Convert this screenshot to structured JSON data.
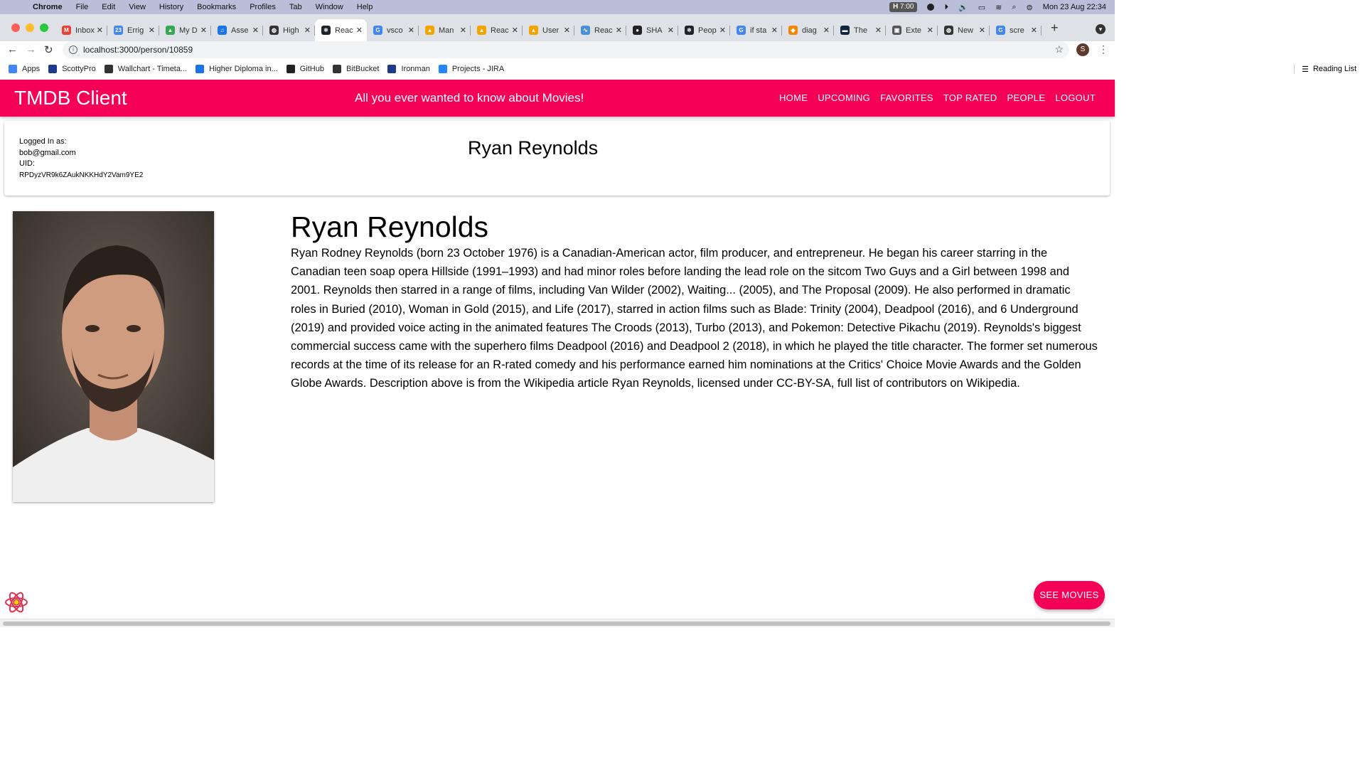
{
  "menubar": {
    "items": [
      "Chrome",
      "File",
      "Edit",
      "View",
      "History",
      "Bookmarks",
      "Profiles",
      "Tab",
      "Window",
      "Help"
    ],
    "badge": "7:00",
    "badge_letter": "H",
    "datetime": "Mon 23 Aug  22:34"
  },
  "tabs": [
    {
      "label": "Inbox",
      "favicon_color": "#ea4335",
      "favicon_glyph": "M",
      "active": false
    },
    {
      "label": "Errig",
      "favicon_color": "#4285f4",
      "favicon_glyph": "23",
      "active": false
    },
    {
      "label": "My D",
      "favicon_color": "#34a853",
      "favicon_glyph": "▲",
      "active": false
    },
    {
      "label": "Asse",
      "favicon_color": "#1a73e8",
      "favicon_glyph": "♫",
      "active": false
    },
    {
      "label": "High",
      "favicon_color": "#333333",
      "favicon_glyph": "◍",
      "active": false
    },
    {
      "label": "Reac",
      "favicon_color": "#20232a",
      "favicon_glyph": "⚛",
      "active": true
    },
    {
      "label": "vsco",
      "favicon_color": "#4285f4",
      "favicon_glyph": "G",
      "active": false
    },
    {
      "label": "Man",
      "favicon_color": "#f4a400",
      "favicon_glyph": "▲",
      "active": false
    },
    {
      "label": "Reac",
      "favicon_color": "#f4a400",
      "favicon_glyph": "▲",
      "active": false
    },
    {
      "label": "User",
      "favicon_color": "#f4a400",
      "favicon_glyph": "▲",
      "active": false
    },
    {
      "label": "Reac",
      "favicon_color": "#4a90d9",
      "favicon_glyph": "∿",
      "active": false
    },
    {
      "label": "SHA",
      "favicon_color": "#222222",
      "favicon_glyph": "●",
      "active": false
    },
    {
      "label": "Peop",
      "favicon_color": "#20232a",
      "favicon_glyph": "⚛",
      "active": false
    },
    {
      "label": "if sta",
      "favicon_color": "#4285f4",
      "favicon_glyph": "G",
      "active": false
    },
    {
      "label": "diag",
      "favicon_color": "#f08705",
      "favicon_glyph": "◆",
      "active": false
    },
    {
      "label": "The",
      "favicon_color": "#0d253f",
      "favicon_glyph": "▬",
      "active": false
    },
    {
      "label": "Exte",
      "favicon_color": "#555555",
      "favicon_glyph": "▣",
      "active": false
    },
    {
      "label": "New",
      "favicon_color": "#333333",
      "favicon_glyph": "◍",
      "active": false
    },
    {
      "label": "scre",
      "favicon_color": "#4285f4",
      "favicon_glyph": "G",
      "active": false
    }
  ],
  "address": {
    "url": "localhost:3000/person/10859"
  },
  "bookmarks": [
    {
      "label": "Apps",
      "color": "#4285f4"
    },
    {
      "label": "ScottyPro",
      "color": "#1e3a8a"
    },
    {
      "label": "Wallchart - Timeta...",
      "color": "#333333"
    },
    {
      "label": "Higher Diploma in...",
      "color": "#1a73e8"
    },
    {
      "label": "GitHub",
      "color": "#222222"
    },
    {
      "label": "BitBucket",
      "color": "#333333"
    },
    {
      "label": "Ironman",
      "color": "#1e3a8a"
    },
    {
      "label": "Projects - JIRA",
      "color": "#2684ff"
    }
  ],
  "reading_list": "Reading List",
  "app": {
    "brand": "TMDB Client",
    "tagline": "All you ever wanted to know about Movies!",
    "nav": [
      "HOME",
      "UPCOMING",
      "FAVORITES",
      "TOP RATED",
      "PEOPLE",
      "LOGOUT"
    ],
    "accent": "#f50057"
  },
  "user": {
    "logged_label": "Logged In as:",
    "email": "bob@gmail.com",
    "uid_label": "UID:",
    "uid": "RPDyzVR9k6ZAukNKKHdY2Vam9YE2"
  },
  "person": {
    "header_name": "Ryan Reynolds",
    "name": "Ryan Reynolds",
    "bio": "Ryan Rodney Reynolds (born 23 October 1976) is a Canadian-American actor, film producer, and entrepreneur. He began his career starring in the Canadian teen soap opera Hillside (1991–1993) and had minor roles before landing the lead role on the sitcom Two Guys and a Girl between 1998 and 2001. Reynolds then starred in a range of films, including Van Wilder (2002), Waiting... (2005), and The Proposal (2009). He also performed in dramatic roles in Buried (2010), Woman in Gold (2015), and Life (2017), starred in action films such as Blade: Trinity (2004), Deadpool (2016), and 6 Underground (2019) and provided voice acting in the animated features The Croods (2013), Turbo (2013), and Pokemon: Detective Pikachu (2019). Reynolds's biggest commercial success came with the superhero films Deadpool (2016) and Deadpool 2 (2018), in which he played the title character. The former set numerous records at the time of its release for an R-rated comedy and his performance earned him nominations at the Critics' Choice Movie Awards and the Golden Globe Awards. Description above is from the Wikipedia article Ryan Reynolds, licensed under CC-BY-SA, full list of contributors on Wikipedia."
  },
  "fab_label": "SEE MOVIES"
}
